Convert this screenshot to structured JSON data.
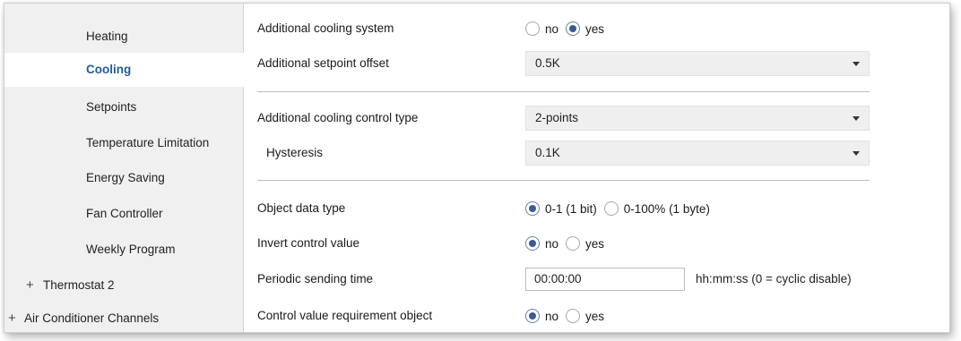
{
  "sidebar": {
    "items": [
      {
        "label": "Heating"
      },
      {
        "label": "Cooling"
      },
      {
        "label": "Setpoints"
      },
      {
        "label": "Temperature Limitation"
      },
      {
        "label": "Energy Saving"
      },
      {
        "label": "Fan Controller"
      },
      {
        "label": "Weekly Program"
      },
      {
        "label": "Thermostat 2",
        "expander": "+"
      },
      {
        "label": "Air Conditioner Channels",
        "expander": "+"
      }
    ],
    "active_index": 1
  },
  "main": {
    "additional_cooling_system": {
      "label": "Additional cooling system",
      "options": [
        "no",
        "yes"
      ],
      "selected": "yes"
    },
    "additional_setpoint_offset": {
      "label": "Additional setpoint offset",
      "value": "0.5K"
    },
    "control_type": {
      "label": "Additional cooling control type",
      "value": "2-points"
    },
    "hysteresis": {
      "label": "Hysteresis",
      "value": "0.1K"
    },
    "object_data_type": {
      "label": "Object data type",
      "options": [
        "0-1 (1 bit)",
        "0-100% (1 byte)"
      ],
      "selected": "0-1 (1 bit)"
    },
    "invert_control_value": {
      "label": "Invert control value",
      "options": [
        "no",
        "yes"
      ],
      "selected": "no"
    },
    "periodic_sending_time": {
      "label": "Periodic sending time",
      "value": "00:00:00",
      "hint": "hh:mm:ss (0 = cyclic disable)"
    },
    "control_value_requirement": {
      "label": "Control value requirement object",
      "options": [
        "no",
        "yes"
      ],
      "selected": "no"
    }
  },
  "colors": {
    "accent": "#1f5d9a",
    "sidebar_bg": "#f0f0f0",
    "select_bg": "#efefef"
  },
  "icons": {
    "dropdown": "chevron-down-icon",
    "expander": "plus-icon"
  }
}
